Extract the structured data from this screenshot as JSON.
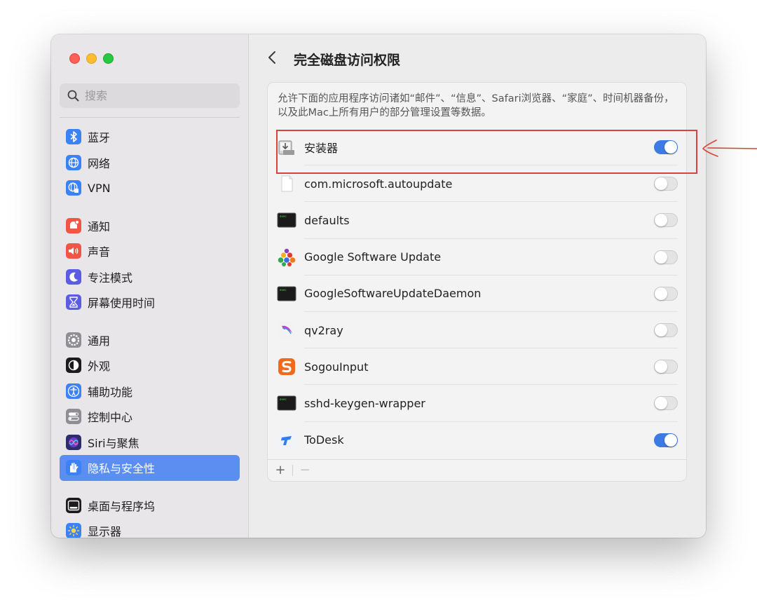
{
  "sidebar": {
    "search_placeholder": "搜索",
    "items": [
      {
        "label": "蓝牙",
        "icon": "bluetooth-icon",
        "color": "#3b82f6"
      },
      {
        "label": "网络",
        "icon": "network-globe-icon",
        "color": "#3b82f6"
      },
      {
        "label": "VPN",
        "icon": "vpn-globe-icon",
        "color": "#3b82f6"
      },
      {
        "label": "通知",
        "icon": "notifications-bell-icon",
        "color": "#f05545"
      },
      {
        "label": "声音",
        "icon": "sound-speaker-icon",
        "color": "#f05545"
      },
      {
        "label": "专注模式",
        "icon": "focus-moon-icon",
        "color": "#5b5ce2"
      },
      {
        "label": "屏幕使用时间",
        "icon": "screen-time-hourglass-icon",
        "color": "#5b5ce2"
      },
      {
        "label": "通用",
        "icon": "general-gear-icon",
        "color": "#8e8e93"
      },
      {
        "label": "外观",
        "icon": "appearance-icon",
        "color": "#1c1c1e"
      },
      {
        "label": "辅助功能",
        "icon": "accessibility-icon",
        "color": "#3b82f6"
      },
      {
        "label": "控制中心",
        "icon": "control-center-icon",
        "color": "#8e8e93"
      },
      {
        "label": "Siri与聚焦",
        "icon": "siri-icon",
        "color": "#2d2d6e"
      },
      {
        "label": "隐私与安全性",
        "icon": "privacy-hand-icon",
        "color": "#3b82f6"
      },
      {
        "label": "桌面与程序坞",
        "icon": "desktop-dock-icon",
        "color": "#1c1c1e"
      },
      {
        "label": "显示器",
        "icon": "display-sun-icon",
        "color": "#3b82f6"
      }
    ]
  },
  "main": {
    "back_icon": "chevron-left-icon",
    "title": "完全磁盘访问权限",
    "description": "允许下面的应用程序访问诸如“邮件”、“信息”、Safari浏览器、“家庭”、时间机器备份，以及此Mac上所有用户的部分管理设置等数据。",
    "apps": [
      {
        "name": "安装器",
        "icon": "installer-icon",
        "enabled": true
      },
      {
        "name": "com.microsoft.autoupdate",
        "icon": "document-icon",
        "enabled": false
      },
      {
        "name": "defaults",
        "icon": "terminal-exec-icon",
        "enabled": false
      },
      {
        "name": "Google Software Update",
        "icon": "google-software-update-icon",
        "enabled": false
      },
      {
        "name": "GoogleSoftwareUpdateDaemon",
        "icon": "terminal-exec-icon",
        "enabled": false
      },
      {
        "name": "qv2ray",
        "icon": "qv2ray-icon",
        "enabled": false
      },
      {
        "name": "SogouInput",
        "icon": "sogou-input-icon",
        "enabled": false
      },
      {
        "name": "sshd-keygen-wrapper",
        "icon": "terminal-exec-icon",
        "enabled": false
      },
      {
        "name": "ToDesk",
        "icon": "todesk-icon",
        "enabled": true
      }
    ],
    "footer": {
      "add": "+",
      "remove": "−"
    }
  },
  "colors": {
    "accent": "#3d7ae4",
    "annotation": "#d9443a"
  }
}
